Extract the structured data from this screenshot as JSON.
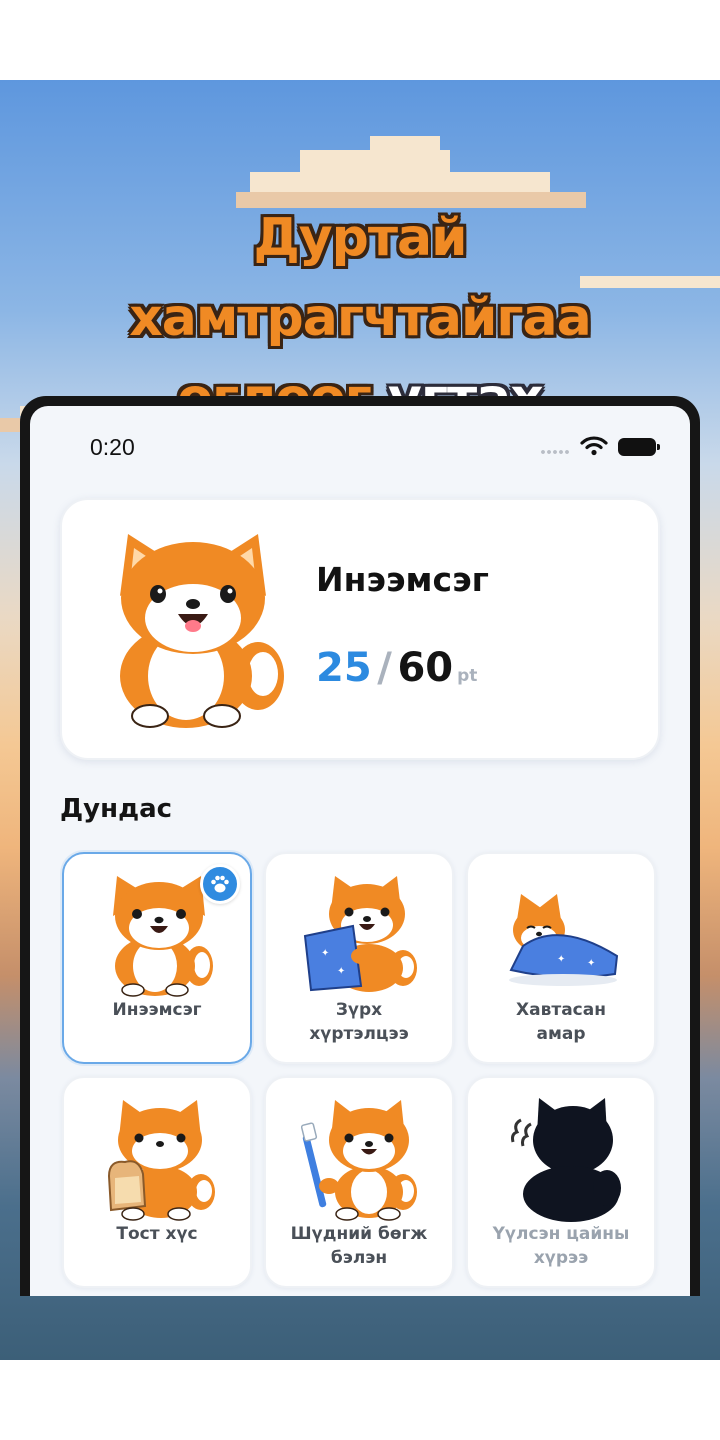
{
  "headline": {
    "line1": "Дуртай",
    "line2": "хамтрагчтайгаа",
    "line3_orange": "өглөөг",
    "line3_white": "угтах"
  },
  "status_bar": {
    "time": "0:20",
    "icons": [
      "signal-dots-icon",
      "wifi-icon",
      "battery-icon"
    ]
  },
  "pet": {
    "name": "Инээмсэг",
    "points_current": "25",
    "points_separator": "/",
    "points_max": "60",
    "points_unit": "pt"
  },
  "section": {
    "title": "Дундас"
  },
  "outfits": [
    {
      "label": "Инээмсэг",
      "selected": true
    },
    {
      "label": "Зүрх\nхүртэлцээ",
      "selected": false
    },
    {
      "label": "Хавтасан\nамар",
      "selected": false
    },
    {
      "label": "Тост хүс",
      "selected": false
    },
    {
      "label": "Шүдний бөгж\nбэлэн",
      "selected": false
    },
    {
      "label": "Үүлсэн цайны\nхүрээ",
      "selected": false,
      "locked": true
    }
  ],
  "colors": {
    "accent_blue": "#2c8ae0",
    "headline_orange": "#f08a24",
    "shiba_orange": "#f08a24"
  }
}
